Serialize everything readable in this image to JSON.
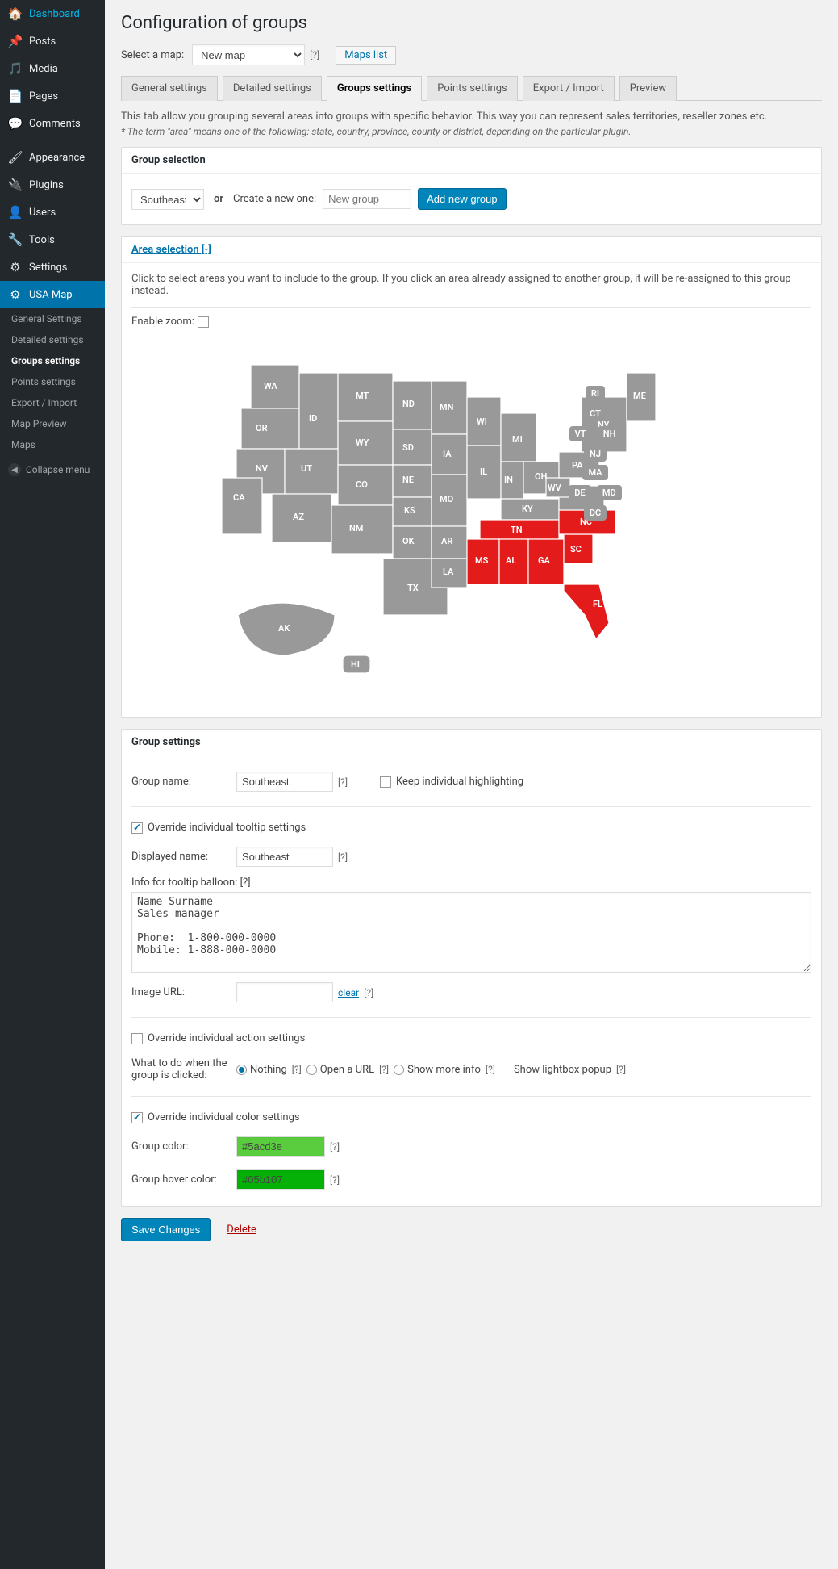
{
  "sidebar": {
    "items": [
      {
        "icon": "🏠",
        "label": "Dashboard"
      },
      {
        "icon": "📌",
        "label": "Posts"
      },
      {
        "icon": "🎵",
        "label": "Media"
      },
      {
        "icon": "📄",
        "label": "Pages"
      },
      {
        "icon": "💬",
        "label": "Comments"
      },
      {
        "icon": "🖌",
        "label": "Appearance"
      },
      {
        "icon": "🔌",
        "label": "Plugins"
      },
      {
        "icon": "👤",
        "label": "Users"
      },
      {
        "icon": "🔧",
        "label": "Tools"
      },
      {
        "icon": "⚙",
        "label": "Settings"
      },
      {
        "icon": "⚙",
        "label": "USA Map"
      }
    ],
    "sub": [
      "General Settings",
      "Detailed settings",
      "Groups settings",
      "Points settings",
      "Export / Import",
      "Map Preview",
      "Maps"
    ],
    "collapse": "Collapse menu"
  },
  "page": {
    "title": "Configuration of groups",
    "select_map_label": "Select a map:",
    "select_map_value": "New map",
    "maps_list": "Maps list",
    "tabs": [
      "General settings",
      "Detailed settings",
      "Groups settings",
      "Points settings",
      "Export / Import",
      "Preview"
    ],
    "note": "This tab allow you grouping several areas into groups with specific behavior. This way you can represent sales territories, reseller zones etc.",
    "note_em": "* The term \"area\" means one of the following: state, country, province, county or district, depending on the particular plugin."
  },
  "group_sel": {
    "title": "Group selection",
    "value": "Southeast",
    "or": "or",
    "create_label": "Create a new one:",
    "placeholder": "New group",
    "add": "Add new group"
  },
  "area": {
    "title": "Area selection [-]",
    "instr": "Click to select areas you want to include to the group. If you click an area already assigned to another group, it will be re-assigned to this group instead.",
    "zoom_label": "Enable zoom:"
  },
  "settings": {
    "title": "Group settings",
    "group_name_label": "Group name:",
    "group_name": "Southeast",
    "keep_highlight": "Keep individual highlighting",
    "override_tooltip": "Override individual tooltip settings",
    "displayed_name_label": "Displayed name:",
    "displayed_name": "Southeast",
    "info_label": "Info for tooltip balloon: [?]",
    "info_text": "Name Surname\nSales manager\n\nPhone:  1-800-000-0000\nMobile: 1-888-000-0000",
    "image_url_label": "Image URL:",
    "clear": "clear",
    "override_action": "Override individual action settings",
    "action_label": "What to do when the group is clicked:",
    "actions": [
      "Nothing",
      "Open a URL",
      "Show more info",
      "Show lightbox popup"
    ],
    "override_color": "Override individual color settings",
    "group_color_label": "Group color:",
    "group_color": "#5acd3e",
    "hover_color_label": "Group hover color:",
    "hover_color": "#05b107"
  },
  "footer": {
    "save": "Save Changes",
    "delete": "Delete"
  },
  "badges": [
    "RI",
    "CT",
    "VT",
    "NH",
    "NJ",
    "MA",
    "DE",
    "MD",
    "DC"
  ]
}
